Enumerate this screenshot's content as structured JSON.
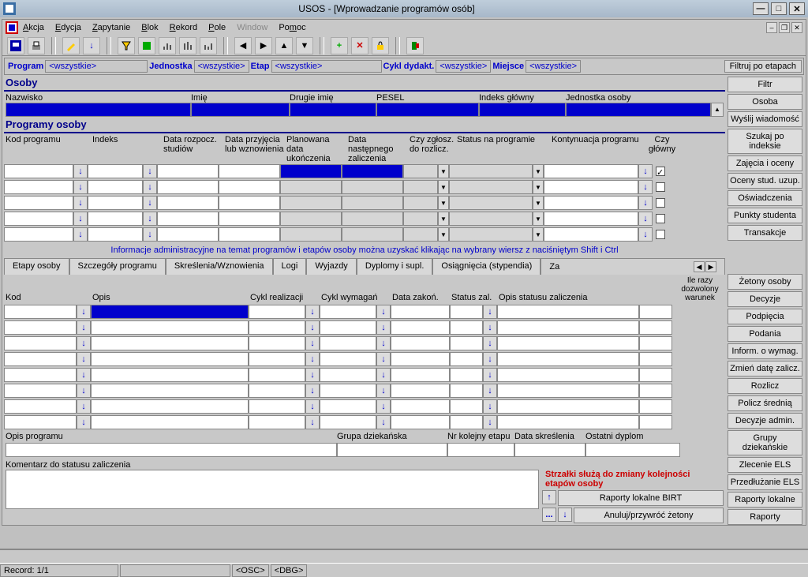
{
  "title": "USOS - [Wprowadzanie programów osób]",
  "menu": {
    "akcja": "Akcja",
    "edycja": "Edycja",
    "zapytanie": "Zapytanie",
    "blok": "Blok",
    "rekord": "Rekord",
    "pole": "Pole",
    "window": "Window",
    "pomoc": "Pomoc"
  },
  "filters": {
    "program": "Program",
    "program_v": "<wszystkie>",
    "jednostka": "Jednostka",
    "jednostka_v": "<wszystkie>",
    "etap": "Etap",
    "etap_v": "<wszystkie>",
    "cykl": "Cykl dydakt.",
    "cykl_v": "<wszystkie>",
    "miejsce": "Miejsce",
    "miejsce_v": "<wszystkie>",
    "filtruj": "Filtruj po etapach"
  },
  "sections": {
    "osoby": "Osoby",
    "programy": "Programy osoby"
  },
  "osoby_headers": {
    "nazwisko": "Nazwisko",
    "imie": "Imię",
    "drugie": "Drugie imię",
    "pesel": "PESEL",
    "indeks": "Indeks główny",
    "jedn": "Jednostka osoby"
  },
  "prog_headers": {
    "kod": "Kod programu",
    "indeks": "Indeks",
    "rozp": "Data rozpocz. studiów",
    "przyj": "Data przyjęcia lub wznowienia",
    "plan": "Planowana data ukończenia",
    "nast": "Data następnego zaliczenia",
    "czyz": "Czy zgłosz. do rozlicz.",
    "status": "Status na programie",
    "kont": "Kontynuacja programu",
    "czyg": "Czy główny"
  },
  "side_buttons": [
    "Filtr",
    "Osoba",
    "Wyślij wiadomość",
    "Szukaj po indeksie",
    "Zajęcia i oceny",
    "Oceny stud. uzup.",
    "Oświadczenia",
    "Punkty studenta",
    "Transakcje",
    "",
    "Żetony osoby",
    "Decyzje",
    "Podpięcia",
    "Podania",
    "Inform. o wymag.",
    "Zmień datę zalicz.",
    "Rozlicz",
    "Policz średnią",
    "Decyzje admin.",
    "Grupy dziekańskie",
    "Zlecenie ELS",
    "Przedłużanie ELS",
    "Raporty lokalne",
    "Raporty"
  ],
  "info": "Informacje administracyjne na temat programów i etapów osoby można uzyskać klikając na wybrany wiersz z naciśniętym Shift i Ctrl",
  "tabs": [
    "Etapy osoby",
    "Szczegóły programu",
    "Skreślenia/Wznowienia",
    "Logi",
    "Wyjazdy",
    "Dyplomy i supl.",
    "Osiągnięcia (stypendia)",
    "Za"
  ],
  "etap_headers": {
    "kod": "Kod",
    "opis": "Opis",
    "cyklr": "Cykl realizacji",
    "cyklw": "Cykl wymagań",
    "dataz": "Data zakoń.",
    "statz": "Status zal.",
    "opiss": "Opis statusu zaliczenia",
    "ile": "Ile razy dozwolony warunek"
  },
  "bottom_labels": {
    "opisp": "Opis programu",
    "grupa": "Grupa dziekańska",
    "nrk": "Nr kolejny etapu",
    "datas": "Data skreślenia",
    "ostd": "Ostatni dyplom",
    "kom": "Komentarz do statusu zaliczenia"
  },
  "red_note": "Strzałki służą do zmiany kolejności etapów osoby",
  "action_buttons": {
    "birt": "Raporty lokalne BIRT",
    "anuluj": "Anuluj/przywróć żetony"
  },
  "status": {
    "record": "Record: 1/1",
    "osc": "<OSC>",
    "dbg": "<DBG>"
  }
}
